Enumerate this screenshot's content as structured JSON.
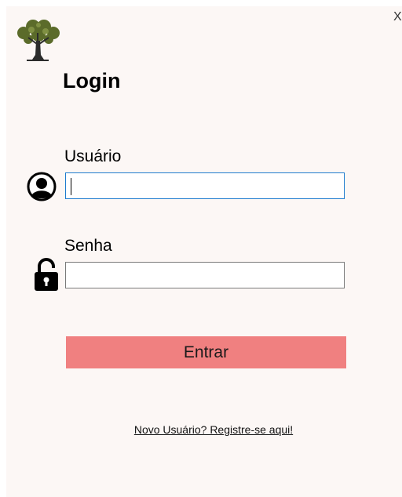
{
  "window": {
    "close_label": "X"
  },
  "header": {
    "title": "Login",
    "logo_icon": "tree-icon"
  },
  "username": {
    "label": "Usuário",
    "value": "",
    "icon": "user-icon"
  },
  "password": {
    "label": "Senha",
    "value": "",
    "icon": "lock-icon"
  },
  "submit": {
    "label": "Entrar",
    "color": "#f08080"
  },
  "register_link": {
    "label": "Novo Usuário? Registre-se aqui!"
  },
  "colors": {
    "background": "#fcf7f5",
    "focus_border": "#1f7ccf"
  }
}
